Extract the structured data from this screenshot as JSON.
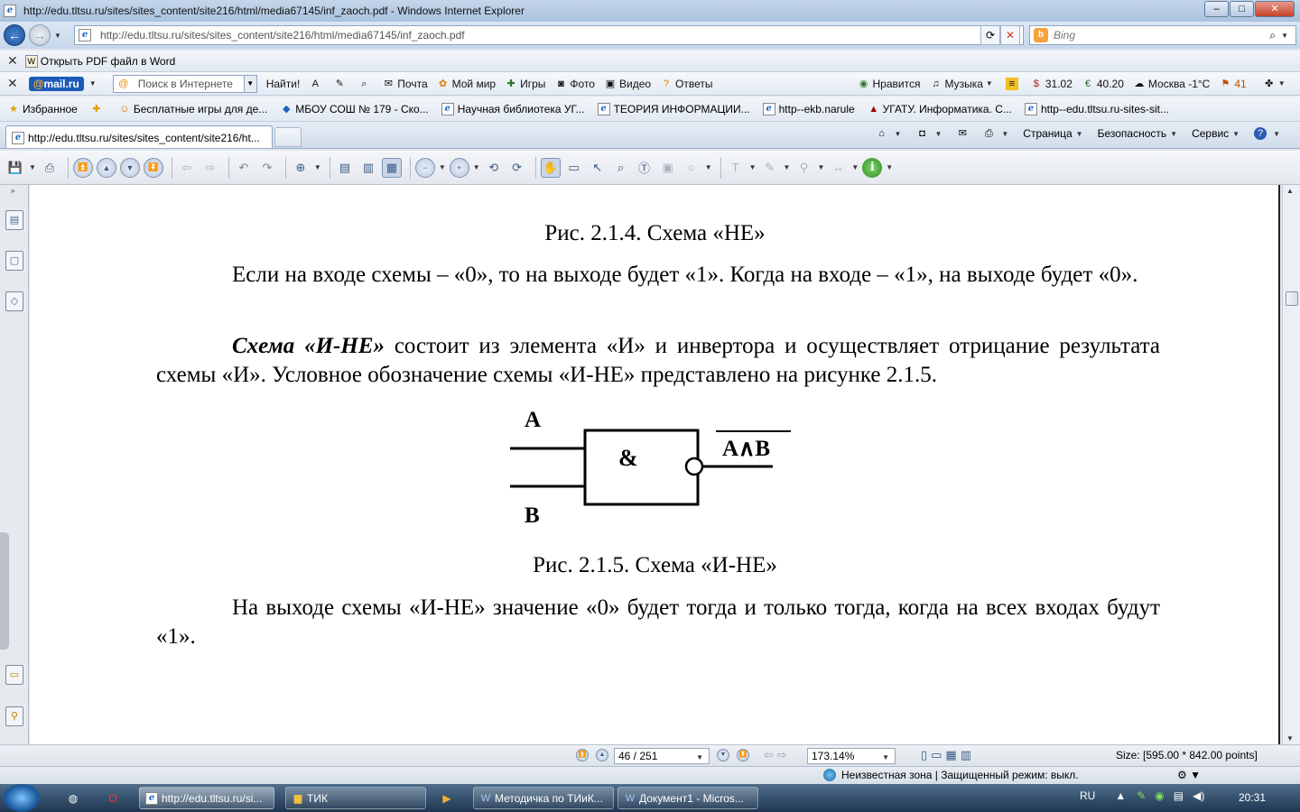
{
  "window": {
    "title": "http://edu.tltsu.ru/sites/sites_content/site216/html/media67145/inf_zaoch.pdf - Windows Internet Explorer",
    "min": "–",
    "max": "□",
    "close": "✕"
  },
  "address": {
    "url": "http://edu.tltsu.ru/sites/sites_content/site216/html/media67145/inf_zaoch.pdf",
    "search_placeholder": "Bing"
  },
  "wordbar": {
    "label": "Открыть PDF файл в  Word"
  },
  "mailbar": {
    "brand_at": "@",
    "brand": "mail.ru",
    "search_placeholder": "Поиск в Интернете",
    "find": "Найти!",
    "items": [
      "Почта",
      "Мой мир",
      "Игры",
      "Фото",
      "Видео",
      "Ответы"
    ],
    "likes": "Нравится",
    "music": "Музыка",
    "usd": "31.02",
    "eur": "40.20",
    "weather": "Москва -1°C",
    "count": "41"
  },
  "favorites": {
    "label": "Избранное",
    "items": [
      "Бесплатные игры для де...",
      "МБОУ СОШ № 179 - Ско...",
      "Научная библиотека УГ...",
      "ТЕОРИЯ ИНФОРМАЦИИ...",
      "http--ekb.narule",
      "УГАТУ. Информатика. С...",
      "http--edu.tltsu.ru-sites-sit..."
    ]
  },
  "tab": {
    "label": "http://edu.tltsu.ru/sites/sites_content/site216/ht..."
  },
  "commands": {
    "page": "Страница",
    "safety": "Безопасность",
    "service": "Сервис"
  },
  "document": {
    "caption1": "Рис. 2.1.4. Схема «НЕ»",
    "para1": "Если на входе схемы – «0», то на выходе будет «1». Когда на входе – «1», на выходе будет «0».",
    "para2_bold": "Схема «И-НЕ»",
    "para2_rest": " состоит из элемента «И» и инвертора и осуществляет отрицание результата схемы «И». Условное обозначение схемы «И-НЕ» представлено на рисунке 2.1.5.",
    "diagram": {
      "input_a": "A",
      "input_b": "B",
      "gate": "&",
      "output": "A∧B"
    },
    "caption2": "Рис. 2.1.5. Схема «И-НЕ»",
    "para3": "На выходе схемы «И-НЕ» значение «0» будет тогда и только тогда, когда на всех входах будут «1»."
  },
  "pdfstatus": {
    "page": "46 / 251",
    "zoom": "173.14%",
    "size": "Size: [595.00 * 842.00 points]"
  },
  "iestatus": {
    "zone": "Неизвестная зона | Защищенный режим: выкл."
  },
  "taskbar": {
    "tasks": [
      "http://edu.tltsu.ru/si...",
      "ТИК",
      "Методичка по ТИиК...",
      "Документ1 - Micros..."
    ],
    "lang": "RU",
    "time": "20:31"
  }
}
